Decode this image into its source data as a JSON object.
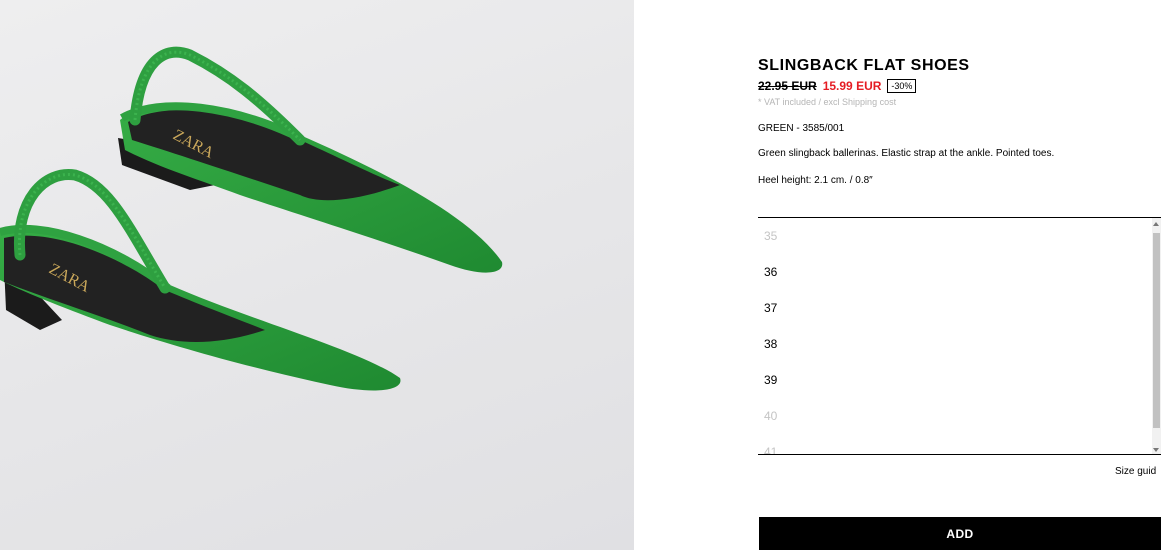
{
  "product": {
    "image_alt": "green slingback flat shoes",
    "brand_insole": "ZARA",
    "title": "SLINGBACK FLAT SHOES",
    "old_price": "22.95 EUR",
    "new_price": "15.99 EUR",
    "discount": "-30%",
    "vat_note": "* VAT included / excl Shipping cost",
    "color_ref": "GREEN - 3585/001",
    "description": "Green slingback ballerinas. Elastic strap at the ankle. Pointed toes.",
    "heel_height": "Heel height: 2.1 cm. / 0.8″"
  },
  "sizes": [
    {
      "label": "35",
      "available": false
    },
    {
      "label": "36",
      "available": true
    },
    {
      "label": "37",
      "available": true
    },
    {
      "label": "38",
      "available": true
    },
    {
      "label": "39",
      "available": true
    },
    {
      "label": "40",
      "available": false
    },
    {
      "label": "41",
      "available": false
    }
  ],
  "actions": {
    "size_guide": "Size guid",
    "add": "ADD"
  },
  "colors": {
    "shoe_green": "#2a9a3b",
    "sale_red": "#e51c23",
    "button_black": "#000000"
  }
}
